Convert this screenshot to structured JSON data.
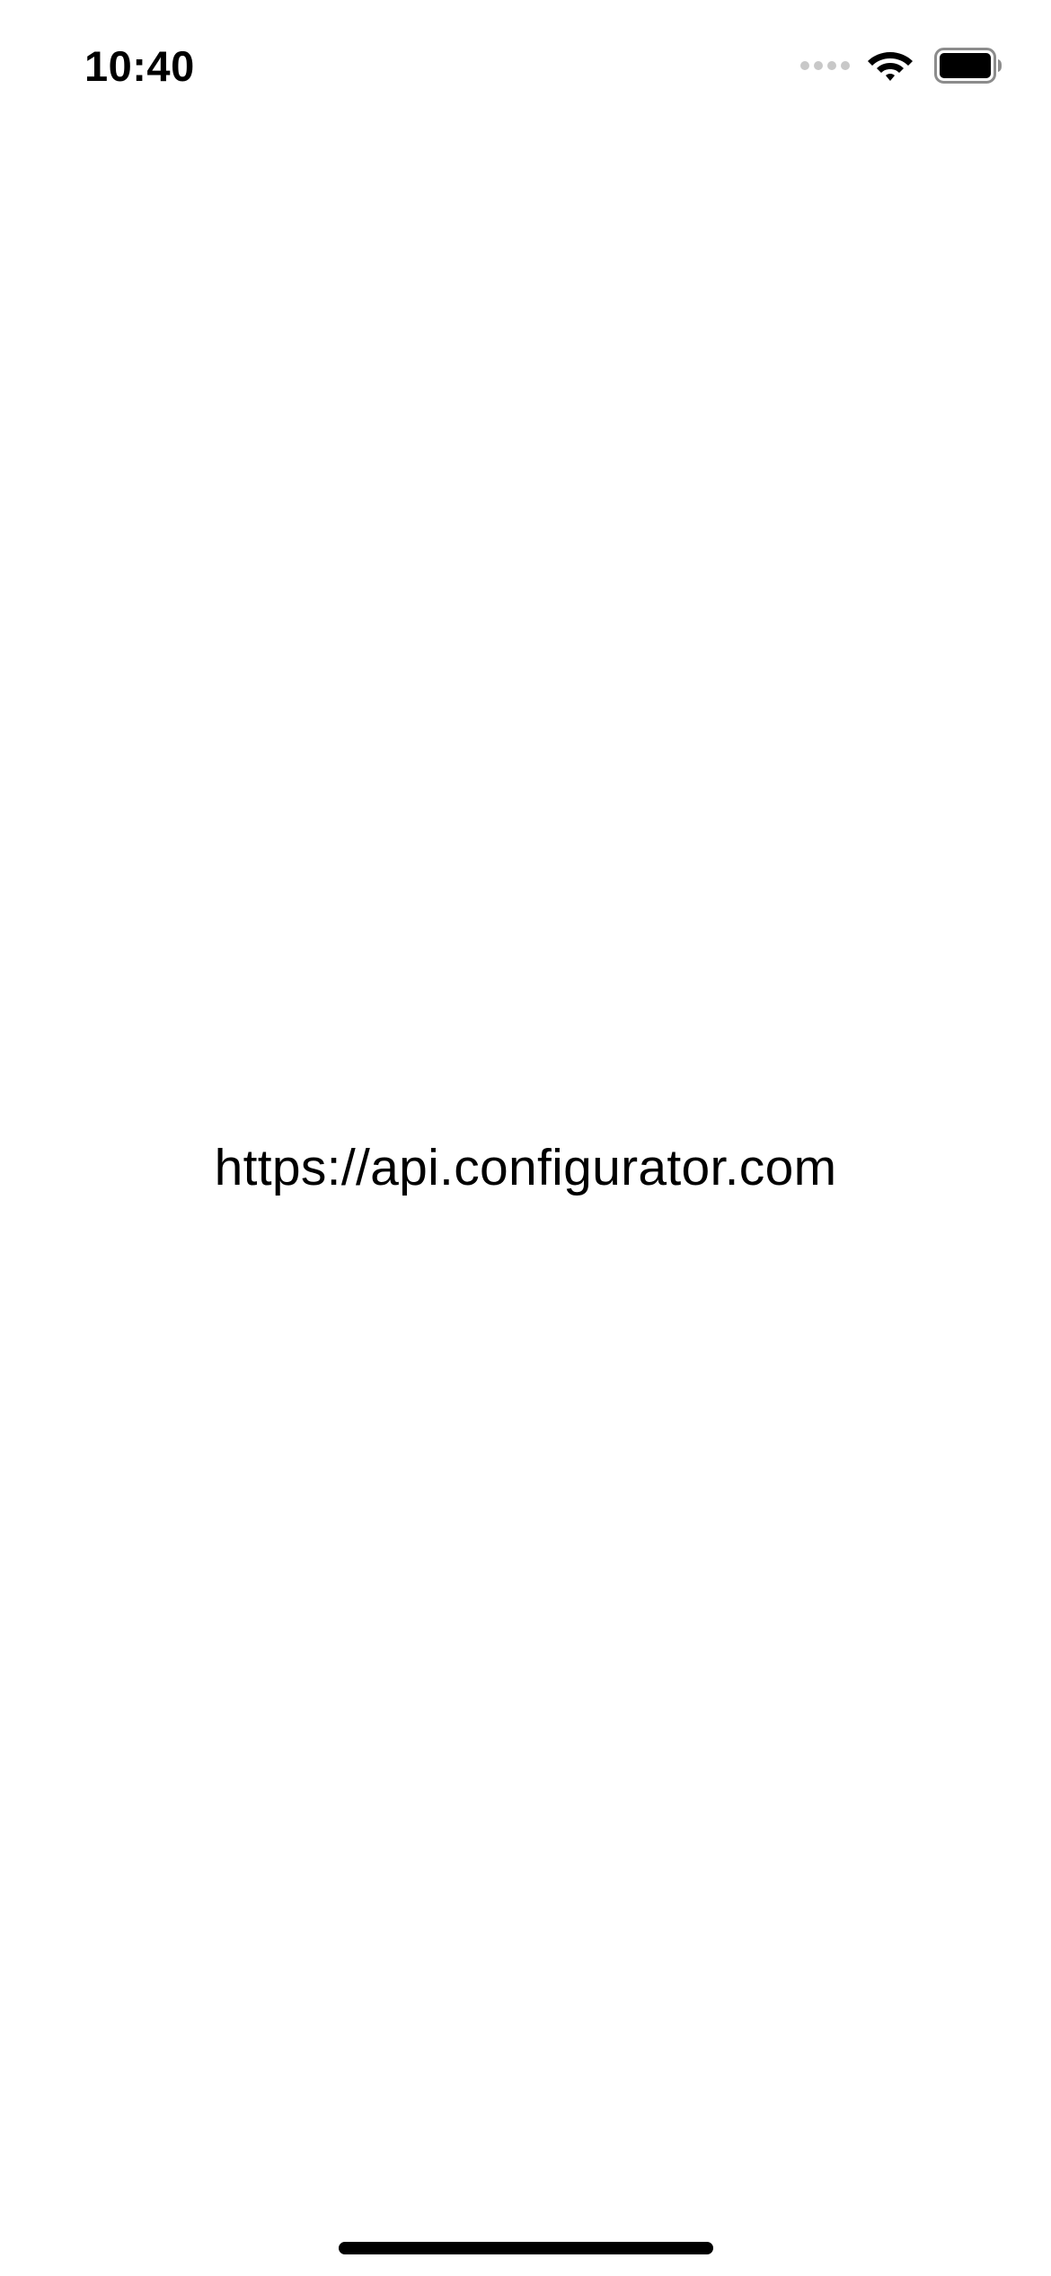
{
  "status_bar": {
    "time": "10:40",
    "icons": [
      "cellular-signal-icon",
      "wifi-icon",
      "battery-icon"
    ]
  },
  "main": {
    "url": "https://api.configurator.com"
  },
  "colors": {
    "background": "#ffffff",
    "text": "#000000",
    "signal_inactive": "#c8c8c8"
  }
}
